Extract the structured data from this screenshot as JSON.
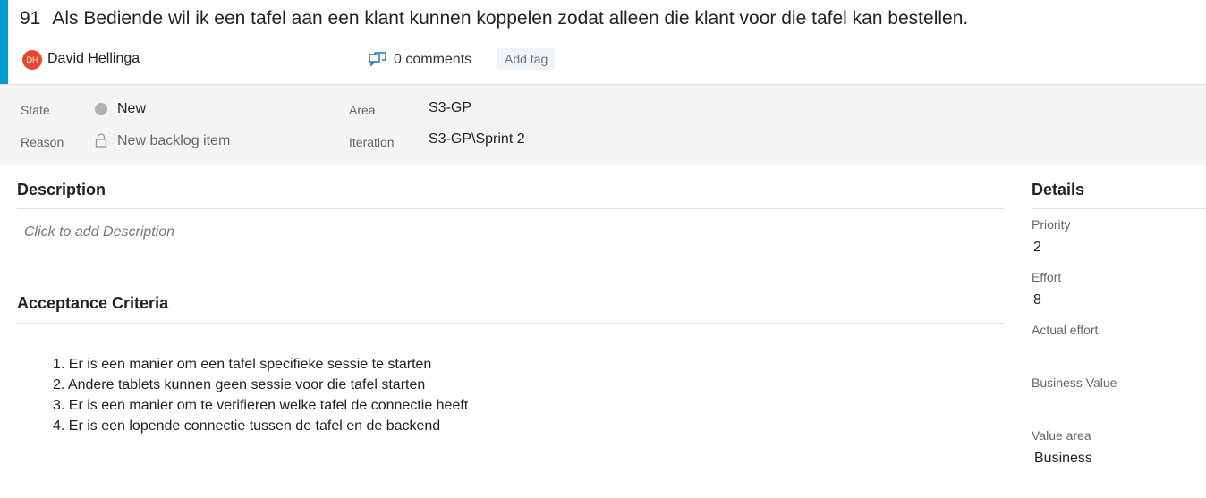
{
  "colors": {
    "accent": "#009ccc",
    "avatar": "#e8472d",
    "state_new": "#b2b2b2",
    "tag_bg": "#eff4f8"
  },
  "work_item": {
    "id": "91",
    "title": "Als Bediende wil ik een tafel aan een klant kunnen koppelen zodat alleen die klant voor die tafel kan bestellen.",
    "author_initials": "DH",
    "author": "David Hellinga",
    "comments": "0 comments",
    "add_tag": "Add tag"
  },
  "fields": {
    "state_label": "State",
    "state_value": "New",
    "reason_label": "Reason",
    "reason_value": "New backlog item",
    "area_label": "Area",
    "area_value": "S3-GP",
    "iteration_label": "Iteration",
    "iteration_value": "S3-GP\\Sprint 2"
  },
  "description": {
    "title": "Description",
    "placeholder": "Click to add Description"
  },
  "acceptance": {
    "title": "Acceptance Criteria",
    "items": [
      "1. Er is een manier om een tafel specifieke sessie te starten",
      "2. Andere tablets kunnen geen sessie voor die tafel starten",
      "3. Er is een manier om te verifieren welke tafel de connectie heeft",
      "4. Er is een lopende connectie tussen de tafel en de backend"
    ]
  },
  "details": {
    "title": "Details",
    "priority_label": "Priority",
    "priority_value": "2",
    "effort_label": "Effort",
    "effort_value": "8",
    "actual_effort_label": "Actual effort",
    "business_value_label": "Business Value",
    "value_area_label": "Value area",
    "value_area_value": "Business"
  }
}
